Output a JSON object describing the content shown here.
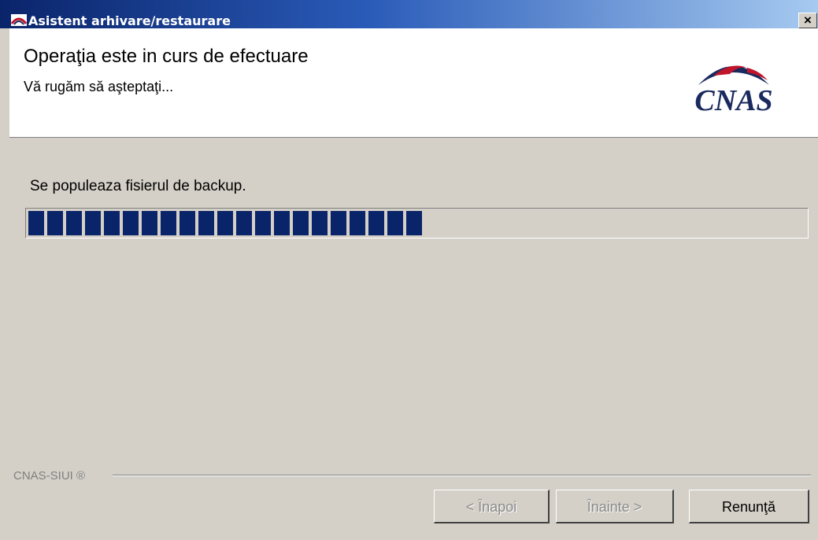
{
  "window": {
    "title": "Asistent arhivare/restaurare",
    "close_label": "×",
    "icon": "cnas-app-icon"
  },
  "header": {
    "title": "Operaţia este in curs de efectuare",
    "subtitle": "Vă rugăm să aşteptaţi...",
    "logo_text": "CNAS"
  },
  "progress": {
    "status_text": "Se populeaza fisierul de backup.",
    "fraction": 0.52
  },
  "footer": {
    "label": "CNAS-SIUI ®"
  },
  "buttons": {
    "back": "< Înapoi",
    "next": "Înainte >",
    "cancel": "Renunţă"
  },
  "colors": {
    "progress_fill": "#0a246a",
    "dialog_background": "#d4d0c8",
    "logo_navy": "#1a2a5e",
    "logo_red": "#c0152b"
  }
}
